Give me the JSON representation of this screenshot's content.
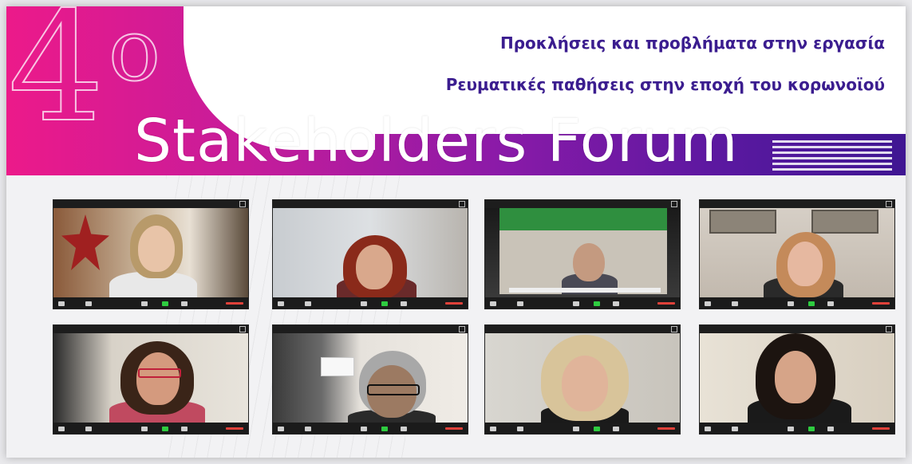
{
  "banner": {
    "number": "4",
    "number_sup": "ο",
    "subtitle_line1": "Προκλήσεις και προβλήματα στην εργασία",
    "subtitle_line2": "Ρευματικές παθήσεις στην εποχή του κορωνοϊού",
    "title": "Stakeholders Forum"
  },
  "colors": {
    "accent_pink": "#ec1a8a",
    "accent_purple": "#3f1692",
    "subtitle_text": "#3b1d8f"
  },
  "participants": [
    {
      "slot": "participant-1"
    },
    {
      "slot": "participant-2"
    },
    {
      "slot": "participant-3"
    },
    {
      "slot": "participant-4"
    },
    {
      "slot": "participant-5"
    },
    {
      "slot": "participant-6"
    },
    {
      "slot": "participant-7"
    },
    {
      "slot": "participant-8"
    }
  ]
}
